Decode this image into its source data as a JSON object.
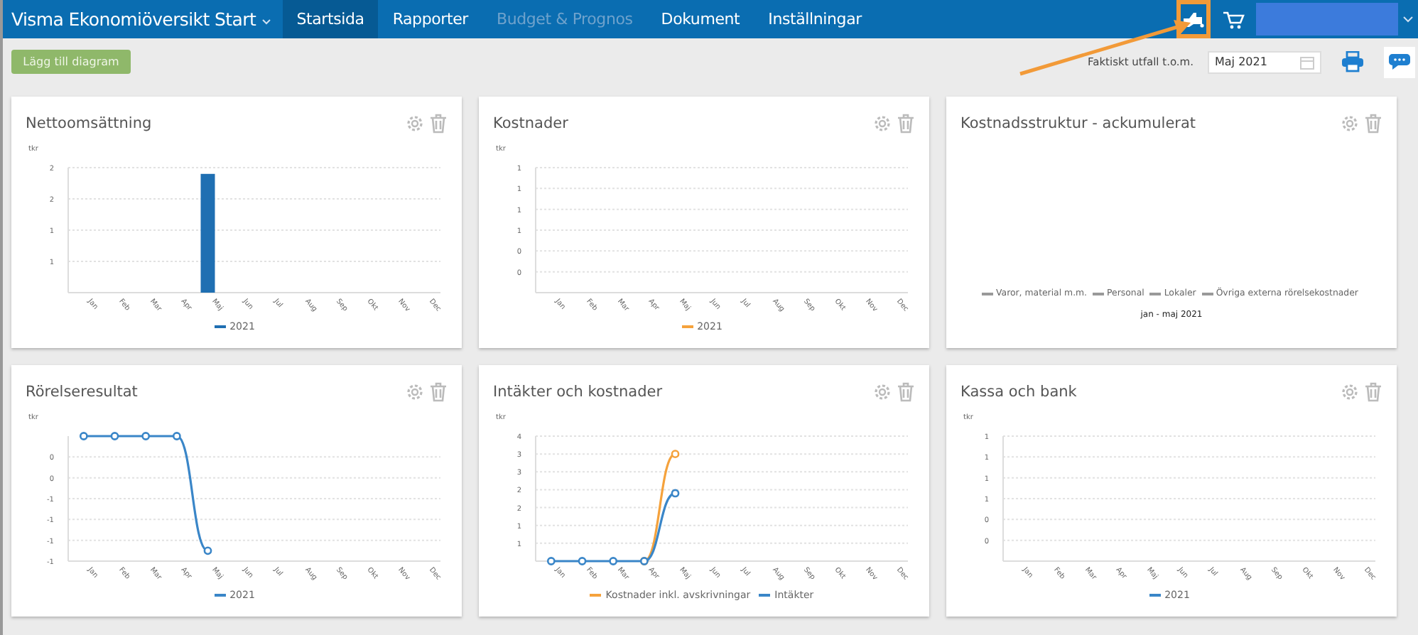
{
  "topbar": {
    "app_menu": "Visma Ekonomiöversikt Start",
    "tabs": [
      {
        "label": "Startsida",
        "selected": true,
        "disabled": false
      },
      {
        "label": "Rapporter",
        "selected": false,
        "disabled": false
      },
      {
        "label": "Budget & Prognos",
        "selected": false,
        "disabled": true
      },
      {
        "label": "Dokument",
        "selected": false,
        "disabled": false
      },
      {
        "label": "Inställningar",
        "selected": false,
        "disabled": false
      }
    ]
  },
  "toolbar": {
    "add_button": "Lägg till diagram",
    "period_label": "Faktiskt utfall t.o.m.",
    "period_value": "Maj 2021"
  },
  "cards": [
    {
      "title": "Nettoomsättning",
      "chart_data": {
        "type": "bar",
        "grid": true,
        "ylabel": "tkr",
        "categories": [
          "Jan",
          "Feb",
          "Mar",
          "Apr",
          "Maj",
          "Jun",
          "Jul",
          "Aug",
          "Sep",
          "Okt",
          "Nov",
          "Dec"
        ],
        "ylim": [
          0,
          2
        ],
        "yticks": [
          {
            "value": 0.5,
            "label": "1"
          },
          {
            "value": 1,
            "label": "1"
          },
          {
            "value": 1.5,
            "label": "2"
          },
          {
            "value": 2,
            "label": "2"
          }
        ],
        "series": [
          {
            "name": "2021",
            "color": "#1f6fb2",
            "values": [
              null,
              null,
              null,
              null,
              1.9,
              null,
              null,
              null,
              null,
              null,
              null,
              null
            ]
          }
        ]
      }
    },
    {
      "title": "Kostnader",
      "chart_data": {
        "type": "line",
        "grid": true,
        "ylabel": "tkr",
        "categories": [
          "Jan",
          "Feb",
          "Mar",
          "Apr",
          "Maj",
          "Jun",
          "Jul",
          "Aug",
          "Sep",
          "Okt",
          "Nov",
          "Dec"
        ],
        "ylim": [
          0,
          1.2
        ],
        "yticks": [
          {
            "value": 0.2,
            "label": "0"
          },
          {
            "value": 0.4,
            "label": "0"
          },
          {
            "value": 0.6,
            "label": "1"
          },
          {
            "value": 0.8,
            "label": "1"
          },
          {
            "value": 1,
            "label": "1"
          },
          {
            "value": 1.2,
            "label": "1"
          }
        ],
        "series": [
          {
            "name": "2021",
            "color": "#f5a23c",
            "values": [
              null,
              null,
              null,
              null,
              null,
              null,
              null,
              null,
              null,
              null,
              null,
              null
            ]
          }
        ]
      }
    },
    {
      "title": "Kostnadsstruktur - ackumulerat",
      "legend": [
        "Varor, material m.m.",
        "Personal",
        "Lokaler",
        "Övriga externa rörelsekostnader"
      ],
      "period": "jan - maj 2021"
    },
    {
      "title": "Rörelseresultat",
      "chart_data": {
        "type": "line",
        "grid": true,
        "ylabel": "tkr",
        "categories": [
          "Jan",
          "Feb",
          "Mar",
          "Apr",
          "Maj",
          "Jun",
          "Jul",
          "Aug",
          "Sep",
          "Okt",
          "Nov",
          "Dec"
        ],
        "ylim": [
          -1.2,
          0
        ],
        "yticks": [
          {
            "value": -1.2,
            "label": "-1"
          },
          {
            "value": -1,
            "label": "-1"
          },
          {
            "value": -0.8,
            "label": "-1"
          },
          {
            "value": -0.6,
            "label": "-1"
          },
          {
            "value": -0.4,
            "label": "0"
          },
          {
            "value": -0.2,
            "label": "0"
          }
        ],
        "series": [
          {
            "name": "2021",
            "color": "#3a86c8",
            "marker": true,
            "values": [
              0,
              0,
              0,
              0,
              -1.1,
              null,
              null,
              null,
              null,
              null,
              null,
              null
            ]
          }
        ]
      }
    },
    {
      "title": "Intäkter och kostnader",
      "chart_data": {
        "type": "line",
        "grid": true,
        "ylabel": "tkr",
        "categories": [
          "Jan",
          "Feb",
          "Mar",
          "Apr",
          "Maj",
          "Jun",
          "Jul",
          "Aug",
          "Sep",
          "Okt",
          "Nov",
          "Dec"
        ],
        "ylim": [
          0,
          3.5
        ],
        "yticks": [
          {
            "value": 0.5,
            "label": "1"
          },
          {
            "value": 1,
            "label": "1"
          },
          {
            "value": 1.5,
            "label": "2"
          },
          {
            "value": 2,
            "label": "2"
          },
          {
            "value": 2.5,
            "label": "3"
          },
          {
            "value": 3,
            "label": "3"
          },
          {
            "value": 3.5,
            "label": "4"
          }
        ],
        "series": [
          {
            "name": "Kostnader inkl. avskrivningar",
            "color": "#f5a23c",
            "marker": true,
            "values": [
              null,
              null,
              null,
              0,
              3,
              null,
              null,
              null,
              null,
              null,
              null,
              null
            ]
          },
          {
            "name": "Intäkter",
            "color": "#3a86c8",
            "marker": true,
            "values": [
              0,
              0,
              0,
              0,
              1.9,
              null,
              null,
              null,
              null,
              null,
              null,
              null
            ]
          }
        ]
      }
    },
    {
      "title": "Kassa och bank",
      "chart_data": {
        "type": "line",
        "grid": true,
        "ylabel": "tkr",
        "categories": [
          "Jan",
          "Feb",
          "Mar",
          "Apr",
          "Maj",
          "Jun",
          "Jul",
          "Aug",
          "Sep",
          "Okt",
          "Nov",
          "Dec"
        ],
        "ylim": [
          0,
          1.2
        ],
        "yticks": [
          {
            "value": 0.2,
            "label": "0"
          },
          {
            "value": 0.4,
            "label": "0"
          },
          {
            "value": 0.6,
            "label": "1"
          },
          {
            "value": 0.8,
            "label": "1"
          },
          {
            "value": 1,
            "label": "1"
          },
          {
            "value": 1.2,
            "label": "1"
          }
        ],
        "series": [
          {
            "name": "2021",
            "color": "#3a86c8",
            "values": [
              null,
              null,
              null,
              null,
              null,
              null,
              null,
              null,
              null,
              null,
              null,
              null
            ]
          }
        ]
      }
    }
  ]
}
